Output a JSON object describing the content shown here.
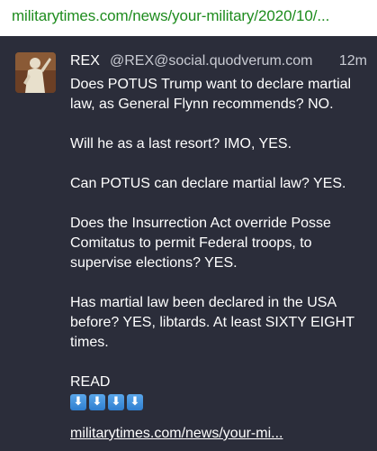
{
  "top_link": {
    "text": "militarytimes.com/news/your-military/2020/10/..."
  },
  "post": {
    "author_name": "REX",
    "author_handle": "@REX@social.quodverum.com",
    "timestamp": "12m",
    "paragraphs": [
      "Does POTUS Trump want to declare martial\nlaw, as General Flynn recommends? NO.",
      "Will he as a last resort? IMO, YES.",
      "Can POTUS can declare martial law?  YES.",
      "Does the Insurrection Act override Posse\nComitatus to permit Federal troops, to\nsupervise elections? YES.",
      "Has martial law been declared in the USA\nbefore? YES, libtards. At least SIXTY EIGHT\ntimes."
    ],
    "read_label": "READ",
    "arrow_emojis": [
      "⬇",
      "⬇",
      "⬇",
      "⬇"
    ],
    "link_text": "militarytimes.com/news/your-mi..."
  },
  "colors": {
    "link_green": "#1e8c1e",
    "card_background": "#2b2d3a",
    "emoji_blue": "#3b8fdd"
  },
  "icons": {
    "avatar": "statue-avatar-icon",
    "arrow": "down-arrow-emoji-icon"
  }
}
